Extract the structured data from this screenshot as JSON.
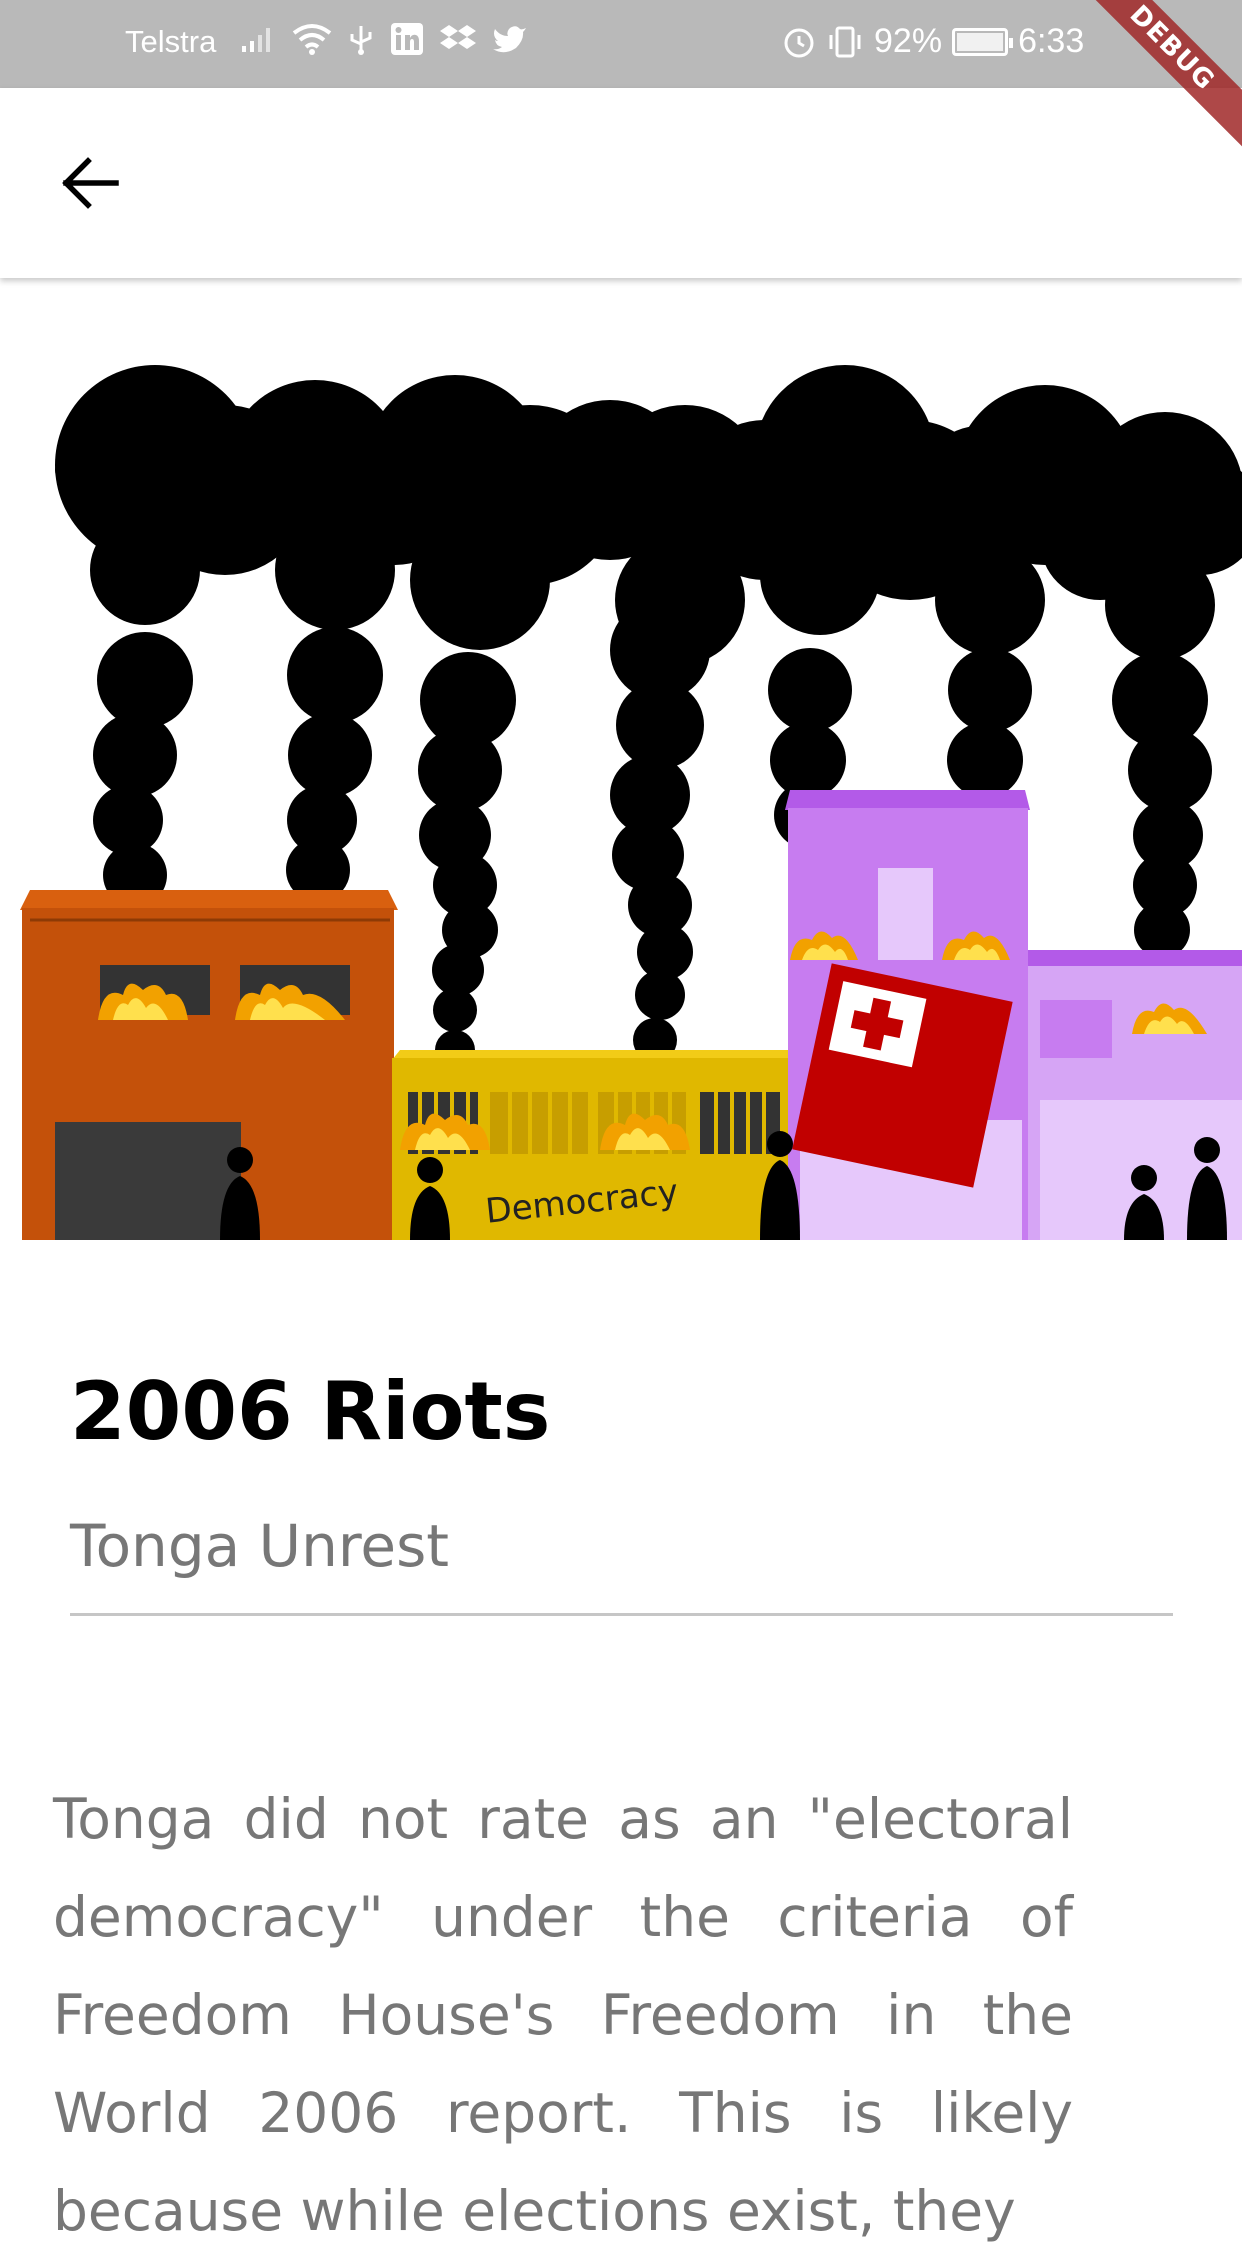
{
  "status_bar": {
    "carrier": "Telstra",
    "battery": "92%",
    "battery_level": 0.92,
    "time": "6:33",
    "icons_left": [
      "signal-icon",
      "wifi-icon",
      "usb-icon",
      "linkedin-icon",
      "dropbox-icon",
      "twitter-icon"
    ],
    "icons_right": [
      "alarm-icon",
      "vibrate-icon",
      "battery-icon"
    ]
  },
  "debug_banner": "DEBUG",
  "app_bar": {
    "back_icon": "arrow-back-icon"
  },
  "illustration": {
    "sign_text": "Democracy",
    "colors": {
      "smoke": "#000000",
      "orange_building": "#c4510a",
      "yellow_building": "#e0b800",
      "purple_building": "#c77cf0",
      "flag_red": "#c10000"
    }
  },
  "article": {
    "title": "2006 Riots",
    "subtitle": "Tonga Unrest",
    "body": "Tonga did not rate as an \"electoral democracy\" under the criteria of Freedom House's Freedom in the World 2006 report. This is likely because while elections exist, they"
  }
}
